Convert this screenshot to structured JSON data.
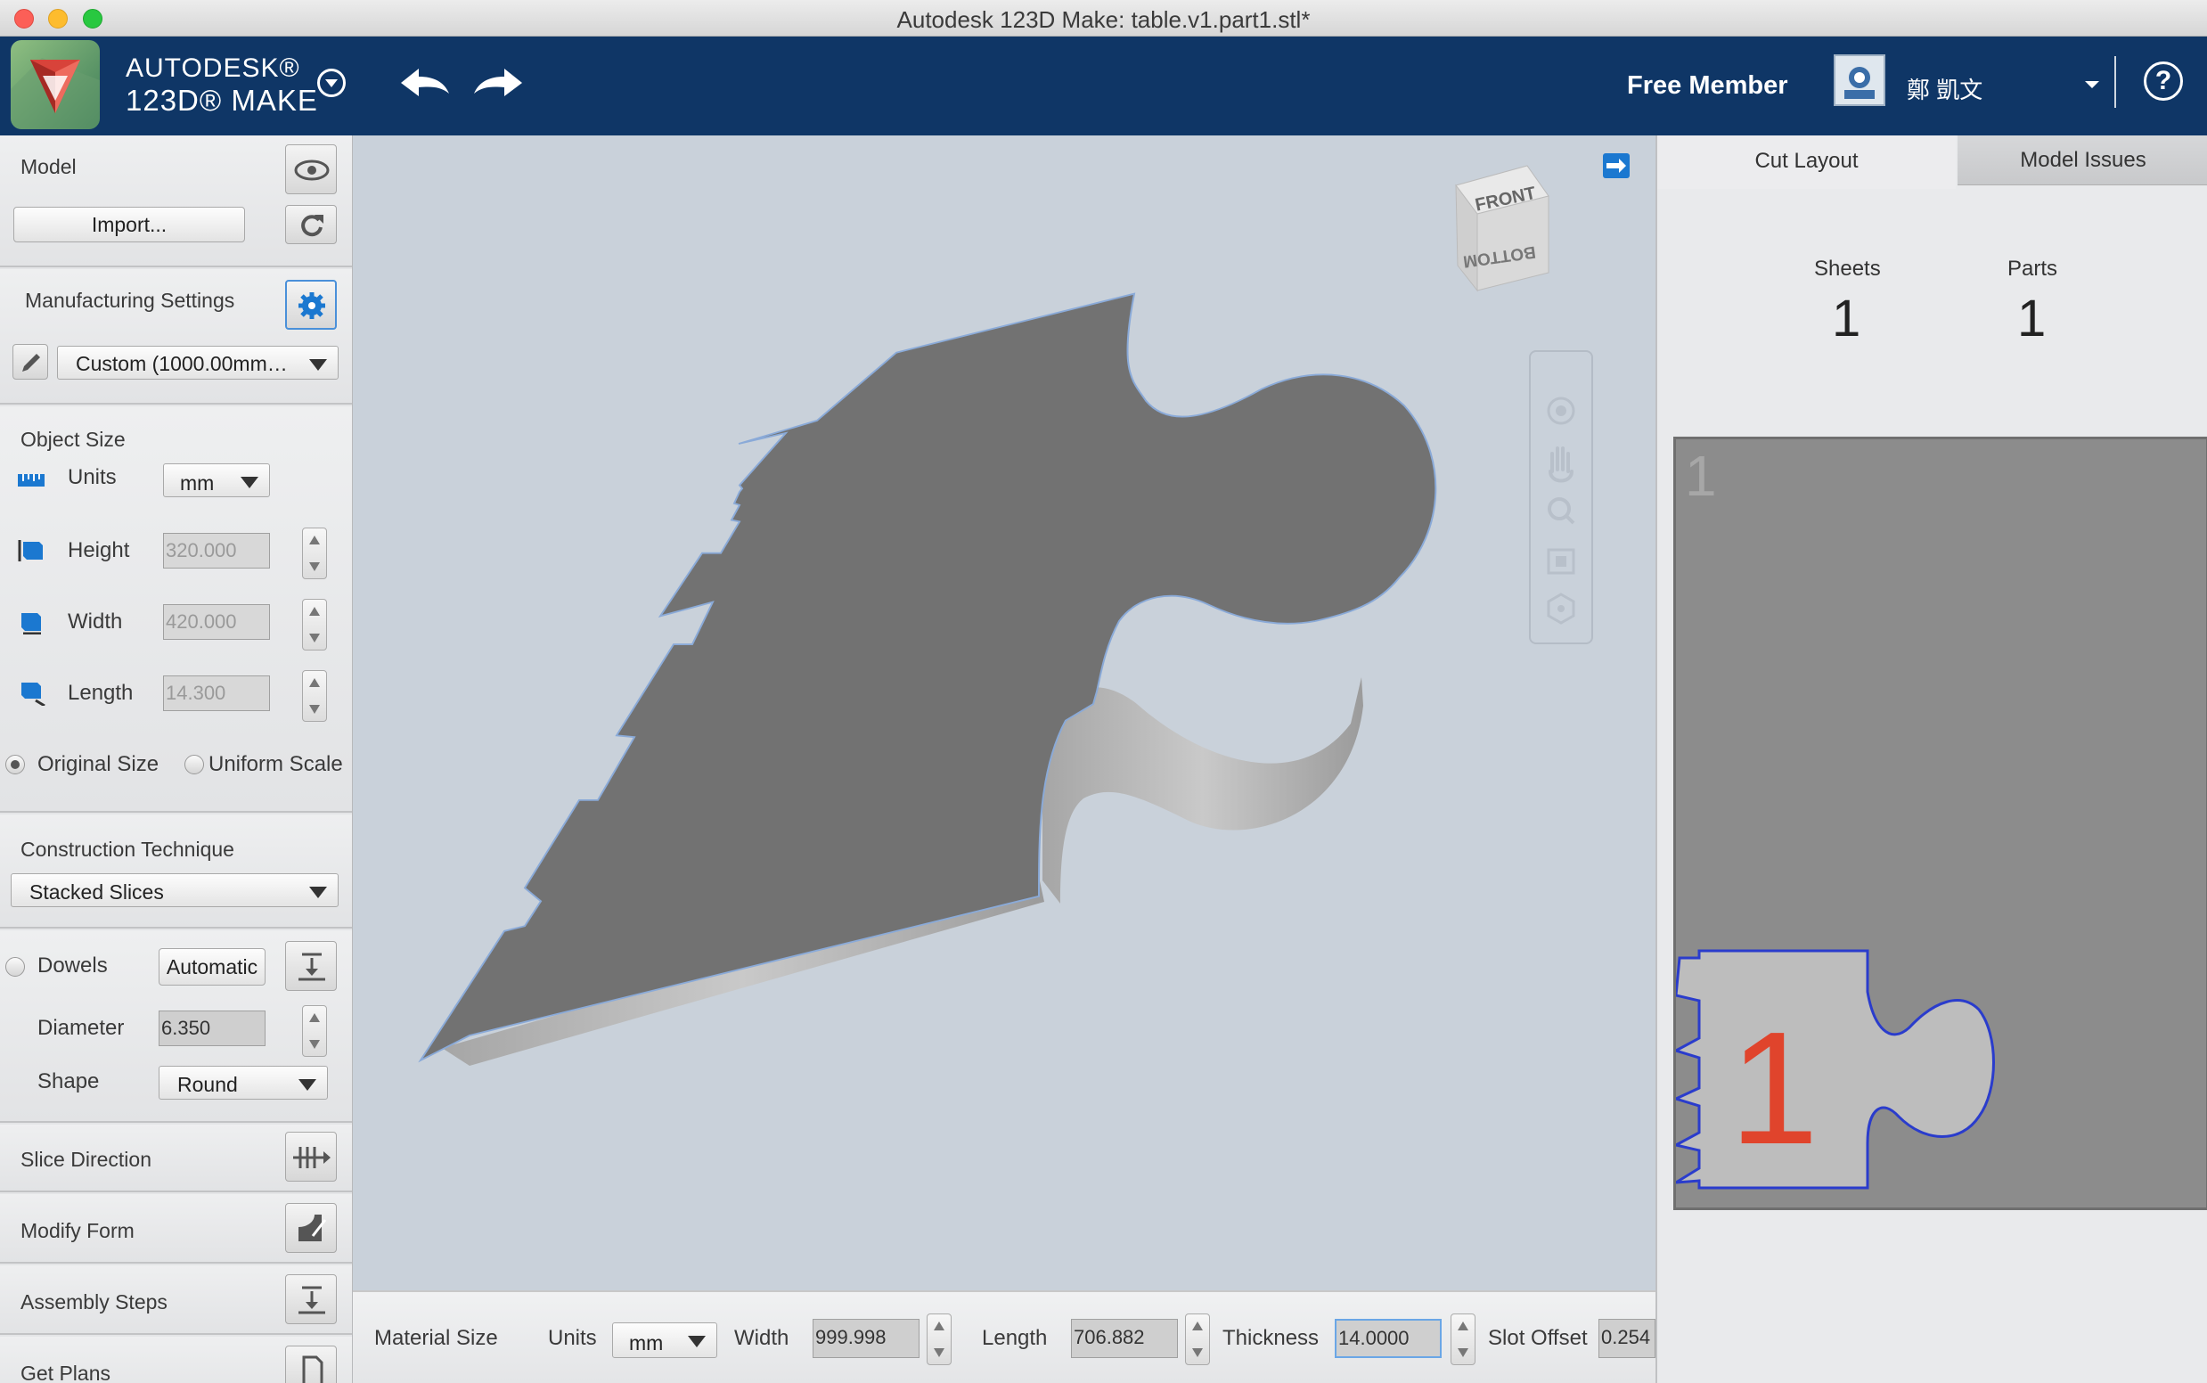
{
  "window": {
    "title": "Autodesk 123D Make: table.v1.part1.stl*"
  },
  "header": {
    "brand_line1": "AUTODESK®",
    "brand_line2": "123D® MAKE",
    "member": "Free Member",
    "user_name": "鄭 凱文",
    "help": "?"
  },
  "model": {
    "label": "Model",
    "import_label": "Import..."
  },
  "manufacturing": {
    "label": "Manufacturing Settings",
    "preset": "Custom (1000.00mm…"
  },
  "object_size": {
    "label": "Object Size",
    "units_label": "Units",
    "units_value": "mm",
    "height_label": "Height",
    "height_value": "320.000",
    "width_label": "Width",
    "width_value": "420.000",
    "length_label": "Length",
    "length_value": "14.300",
    "original_size": "Original Size",
    "uniform_scale": "Uniform Scale"
  },
  "construction": {
    "label": "Construction Technique",
    "value": "Stacked Slices"
  },
  "dowels": {
    "label": "Dowels",
    "mode": "Automatic",
    "diameter_label": "Diameter",
    "diameter_value": "6.350",
    "shape_label": "Shape",
    "shape_value": "Round"
  },
  "sections": {
    "slice_direction": "Slice Direction",
    "modify_form": "Modify Form",
    "assembly_steps": "Assembly Steps",
    "get_plans": "Get Plans"
  },
  "viewcube": {
    "front": "FRONT",
    "bottom": "BOTTOM"
  },
  "material": {
    "label": "Material Size",
    "units_label": "Units",
    "units_value": "mm",
    "width_label": "Width",
    "width_value": "999.998",
    "length_label": "Length",
    "length_value": "706.882",
    "thickness_label": "Thickness",
    "thickness_value": "14.0000",
    "slot_offset_label": "Slot Offset",
    "slot_offset_value": "0.254"
  },
  "right": {
    "tab_cut_layout": "Cut Layout",
    "tab_model_issues": "Model Issues",
    "sheets_label": "Sheets",
    "sheets_value": "1",
    "parts_label": "Parts",
    "parts_value": "1",
    "sheet_number": "1",
    "part_label": "1"
  },
  "colors": {
    "header": "#0f3666",
    "viewport": "#c9d1da",
    "part_fill": "#727272",
    "part_outline": "#2a3ccc",
    "part_label": "#e0442c",
    "accent": "#1b78d0"
  }
}
